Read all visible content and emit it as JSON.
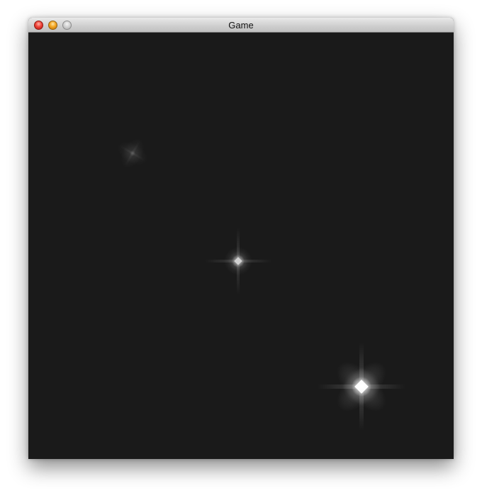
{
  "window": {
    "title": "Game",
    "buttons": {
      "close_color": "#f0443a",
      "minimize_color": "#f3a623",
      "zoom_color": "#cfcfcf"
    }
  },
  "scene": {
    "background_color": "#1a1a1a",
    "particle_color": "#ffffff",
    "particles": [
      {
        "id": "particle-small",
        "brightness": 0.35,
        "size": "small",
        "rotation": 30
      },
      {
        "id": "particle-medium",
        "brightness": 0.8,
        "size": "medium",
        "rotation": 0
      },
      {
        "id": "particle-large",
        "brightness": 1.0,
        "size": "large",
        "rotation": 45
      }
    ]
  }
}
